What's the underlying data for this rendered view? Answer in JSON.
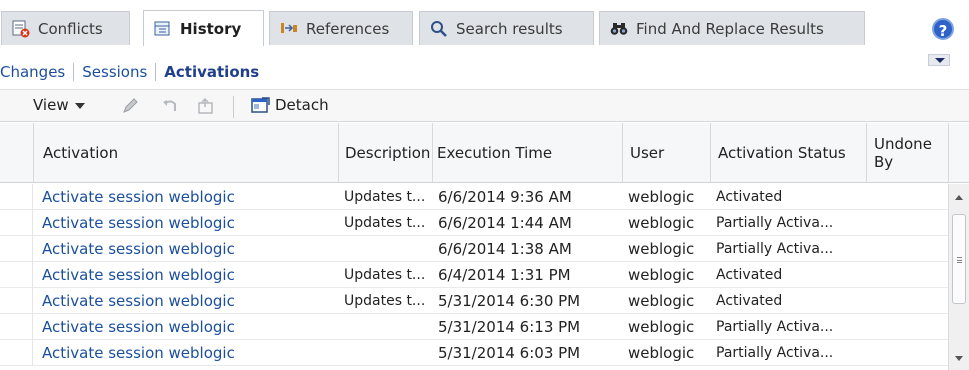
{
  "tabs": [
    {
      "label": "Conflicts",
      "icon": "conflicts-icon",
      "active": false
    },
    {
      "label": "History",
      "icon": "history-icon",
      "active": true
    },
    {
      "label": "References",
      "icon": "references-icon",
      "active": false
    },
    {
      "label": "Search results",
      "icon": "search-icon",
      "active": false
    },
    {
      "label": "Find And Replace Results",
      "icon": "binoculars-icon",
      "active": false
    }
  ],
  "help": {
    "label": "?"
  },
  "subnav": [
    {
      "label": "Changes",
      "active": false
    },
    {
      "label": "Sessions",
      "active": false
    },
    {
      "label": "Activations",
      "active": true
    }
  ],
  "toolbar": {
    "view_label": "View",
    "detach_label": "Detach"
  },
  "columns": {
    "activation": "Activation",
    "description": "Description",
    "execution_time": "Execution Time",
    "user": "User",
    "activation_status": "Activation Status",
    "undone_by": "Undone By"
  },
  "rows": [
    {
      "activation": "Activate session weblogic",
      "description": "Updates t...",
      "time": "6/6/2014 9:36 AM",
      "user": "weblogic",
      "status": "Activated",
      "undone_by": ""
    },
    {
      "activation": "Activate session weblogic",
      "description": "Updates t...",
      "time": "6/6/2014 1:44 AM",
      "user": "weblogic",
      "status": "Partially Activa...",
      "undone_by": ""
    },
    {
      "activation": "Activate session weblogic",
      "description": "",
      "time": "6/6/2014 1:38 AM",
      "user": "weblogic",
      "status": "Partially Activa...",
      "undone_by": ""
    },
    {
      "activation": "Activate session weblogic",
      "description": "Updates t...",
      "time": "6/4/2014 1:31 PM",
      "user": "weblogic",
      "status": "Activated",
      "undone_by": ""
    },
    {
      "activation": "Activate session weblogic",
      "description": "Updates t...",
      "time": "5/31/2014 6:30 PM",
      "user": "weblogic",
      "status": "Activated",
      "undone_by": ""
    },
    {
      "activation": "Activate session weblogic",
      "description": "",
      "time": "5/31/2014 6:13 PM",
      "user": "weblogic",
      "status": "Partially Activa...",
      "undone_by": ""
    },
    {
      "activation": "Activate session weblogic",
      "description": "",
      "time": "5/31/2014 6:03 PM",
      "user": "weblogic",
      "status": "Partially Activa...",
      "undone_by": ""
    }
  ],
  "colors": {
    "link": "#1b4f9c",
    "tab_bg": "#dfe2e6",
    "header_bg": "#f6f7f8"
  }
}
